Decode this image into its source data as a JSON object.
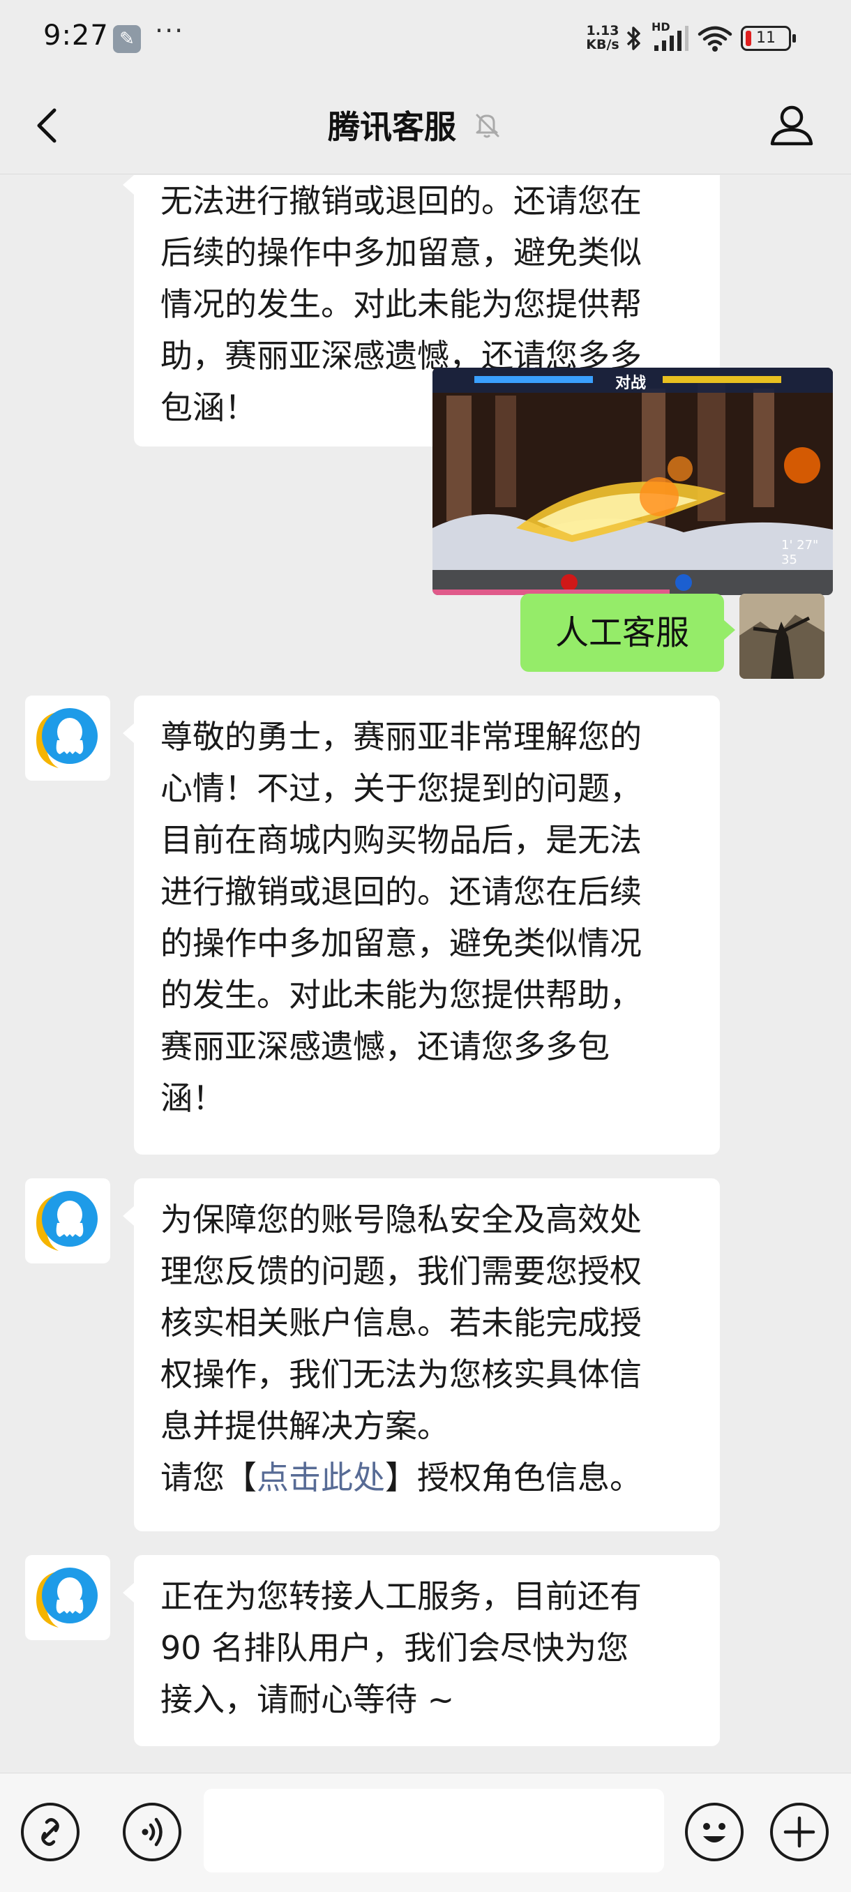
{
  "status_bar": {
    "time": "9:27",
    "wrench_icon": "wrench-icon",
    "dots": "···",
    "net_speed_value": "1.13",
    "net_speed_unit": "KB/s",
    "hd_label": "HD",
    "battery": "11"
  },
  "header": {
    "title": "腾讯客服",
    "back_icon": "chevron-left-icon",
    "mute_icon": "bell-off-icon",
    "profile_icon": "person-icon"
  },
  "messages": {
    "partial_top": {
      "lines": [
        "无法进行撤销或退回的。还请您在",
        "后续的操作中多加留意，避免类似",
        "情况的发生。对此未能为您提供帮",
        "助，赛丽亚深感遗憾，还请您多多",
        "包涵！"
      ]
    },
    "user_reply": "人工客服",
    "bot_1": {
      "lines": [
        "尊敬的勇士，赛丽亚非常理解您的",
        "心情！不过，关于您提到的问题，",
        "目前在商城内购买物品后，是无法",
        "进行撤销或退回的。还请您在后续",
        "的操作中多加留意，避免类似情况",
        "的发生。对此未能为您提供帮助，",
        "赛丽亚深感遗憾，还请您多多包",
        "涵！"
      ]
    },
    "bot_2": {
      "lines": [
        "为保障您的账号隐私安全及高效处",
        "理您反馈的问题，我们需要您授权",
        "核实相关账户信息。若未能完成授",
        "权操作，我们无法为您核实具体信",
        "息并提供解决方案。"
      ],
      "link_prefix": "请您【",
      "link_text": "点击此处",
      "link_suffix": "】授权角色信息。"
    },
    "bot_3": {
      "lines": [
        "正在为您转接人工服务，目前还有",
        "90 名排队用户，我们会尽快为您",
        "接入，请耐心等待 ~"
      ]
    }
  },
  "game_screenshot": {
    "vs_label": "对战",
    "timer": "1' 27\" 35"
  },
  "bottom_bar": {
    "mini_program_icon": "link-icon",
    "voice_icon": "voice-icon",
    "input_placeholder": "",
    "emoji_icon": "emoji-icon",
    "plus_icon": "plus-icon"
  },
  "colors": {
    "background": "#ededed",
    "user_bubble": "#95ec69",
    "bot_bubble": "#ffffff",
    "link": "#576b95",
    "bot_avatar_blue": "#1e9be8",
    "bot_avatar_yellow": "#f5b400"
  }
}
